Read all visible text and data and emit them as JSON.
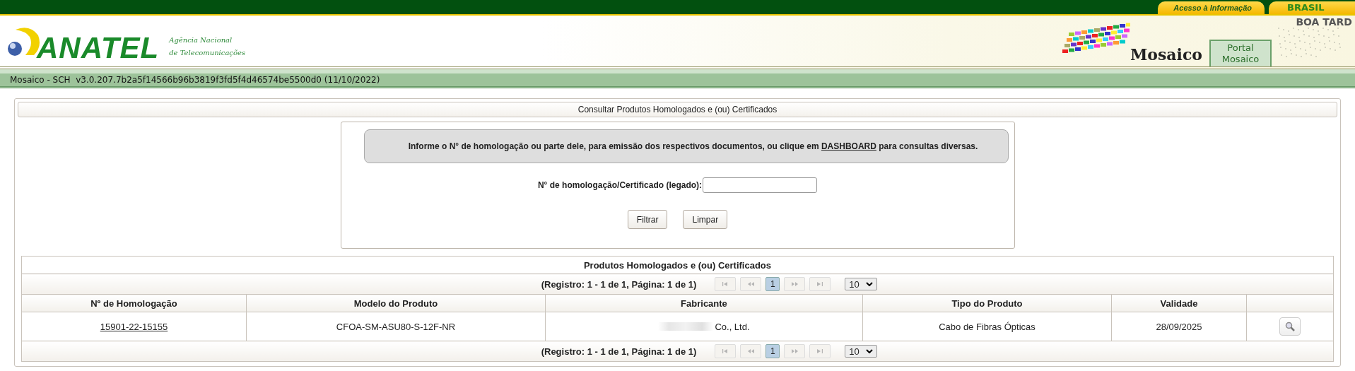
{
  "top_bar": {
    "links": [
      {
        "kind": "access",
        "label": "Acesso à Informação"
      },
      {
        "kind": "country",
        "label": "BRASIL"
      }
    ]
  },
  "header": {
    "logo_text": "ANATEL",
    "agency_name": [
      "Agência Nacional",
      "de Telecomunicações"
    ],
    "app_name": "Mosaico",
    "portal_tab": "Portal Mosaico",
    "greeting": "BOA TARD"
  },
  "version_bar": "Mosaico - SCH  v3.0.207.7b2a5f14566b96b3819f3fd5f4d46574be5500d0 (11/10/2022)",
  "page_title": "Consultar Produtos Homologados e (ou) Certificados",
  "notice": {
    "text": "Informe o N° de homologação ou parte dele, para emissão dos respectivos documentos, ou clique em ",
    "link": "DASHBOARD",
    "text_after": " para consultas diversas."
  },
  "search": {
    "label": "N° de homologação/Certificado (legado):"
  },
  "buttons": [
    "Filtrar",
    "Limpar"
  ],
  "results": {
    "title": "Produtos Homologados e (ou) Certificados",
    "pagers": [
      {
        "summary": "(Registro: 1 - 1 de 1, Página: 1 de 1)",
        "nav": [
          {
            "kind": "first",
            "disabled": true
          },
          {
            "kind": "prev",
            "disabled": true
          },
          {
            "kind": "page",
            "label": "1",
            "selected": true
          },
          {
            "kind": "next",
            "disabled": true
          },
          {
            "kind": "last",
            "disabled": true
          }
        ],
        "page_size": "10"
      },
      {
        "summary": "(Registro: 1 - 1 de 1, Página: 1 de 1)",
        "nav": [
          {
            "kind": "first",
            "disabled": true
          },
          {
            "kind": "prev",
            "disabled": true
          },
          {
            "kind": "page",
            "label": "1",
            "selected": true
          },
          {
            "kind": "next",
            "disabled": true
          },
          {
            "kind": "last",
            "disabled": true
          }
        ],
        "page_size": "10"
      }
    ],
    "columns": [
      "Nº de Homologação",
      "Modelo do Produto",
      "Fabricante",
      "Tipo do Produto",
      "Validade"
    ],
    "rows": [
      {
        "homologation": "15901-22-15155",
        "model": "CFOA-SM-ASU80-S-12F-NR",
        "manufacturer": "Co., Ltd.",
        "product_type": "Cabo de Fibras Ópticas",
        "validity": "28/09/2025"
      }
    ]
  }
}
